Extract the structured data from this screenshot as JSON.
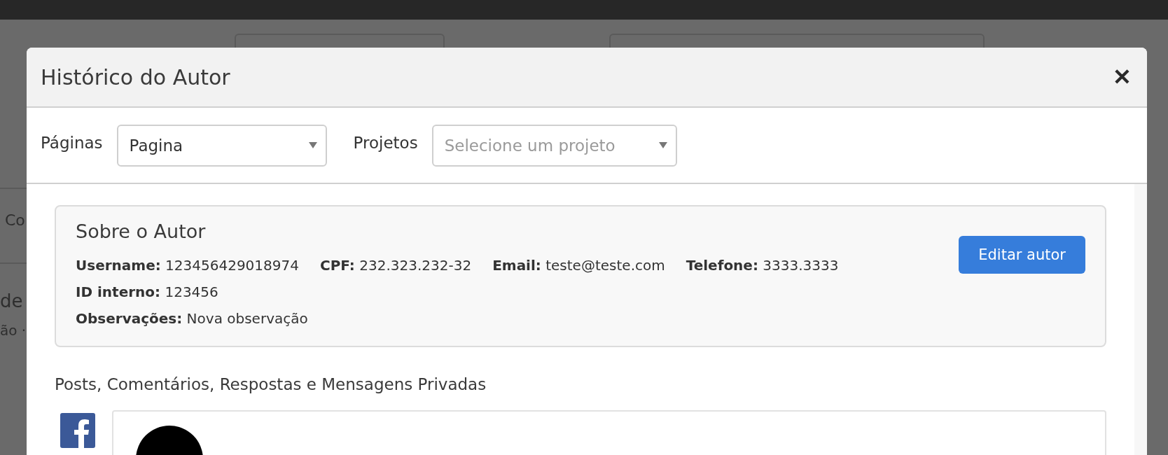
{
  "background": {
    "texts": [
      "Co",
      "de",
      "ão ·"
    ]
  },
  "modal": {
    "title": "Histórico do Autor",
    "close": "✕",
    "filters": [
      {
        "label": "Páginas",
        "value": "Pagina"
      },
      {
        "label": "Projetos",
        "placeholder": "Selecione um projeto"
      }
    ],
    "about": {
      "title": "Sobre o Autor",
      "button": "Editar autor",
      "lines": [
        [
          {
            "label": "Username:",
            "value": "123456429018974"
          },
          {
            "label": "CPF:",
            "value": "232.323.232-32"
          },
          {
            "label": "Email:",
            "value": "teste@teste.com"
          },
          {
            "label": "Telefone:",
            "value": "3333.3333"
          }
        ],
        [
          {
            "label": "ID interno:",
            "value": "123456"
          }
        ],
        [
          {
            "label": "Observações:",
            "value": "Nova observação"
          }
        ]
      ]
    },
    "posts_heading": "Posts, Comentários, Respostas e Mensagens Privadas",
    "posts": [
      {
        "kind": "facebook"
      }
    ]
  }
}
